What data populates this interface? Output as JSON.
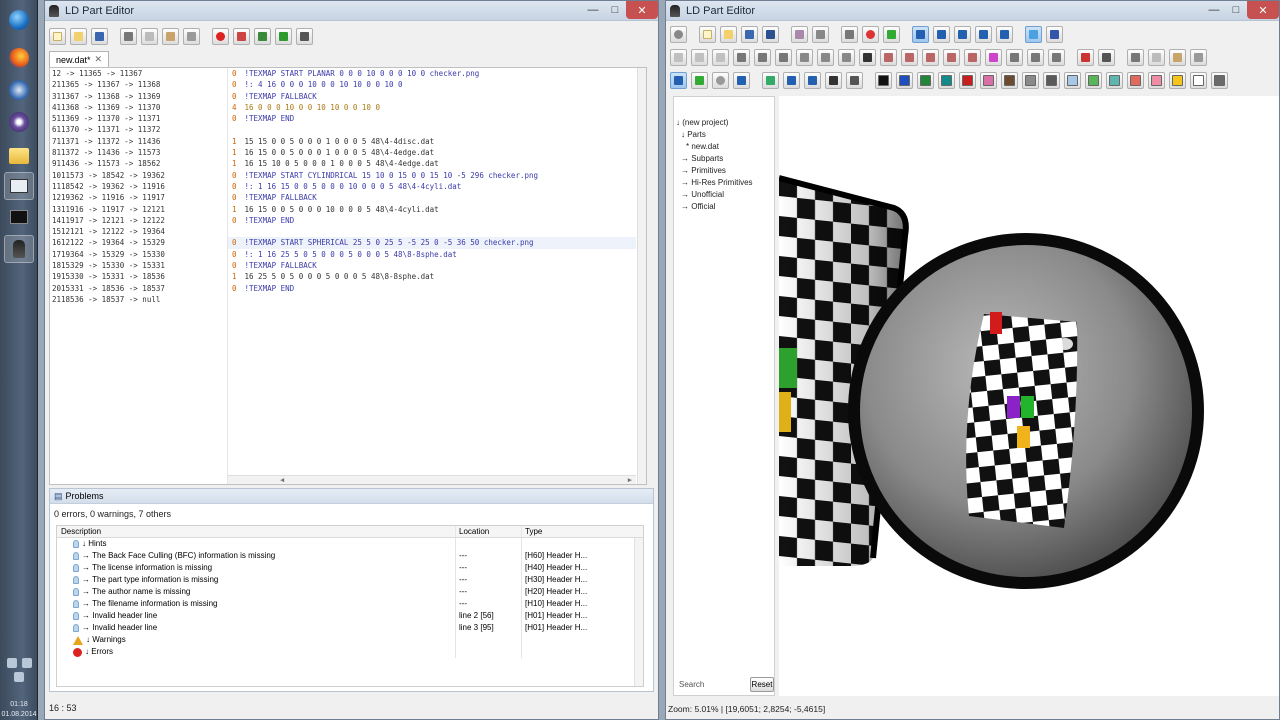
{
  "taskbar": {
    "clock": {
      "time": "01:18",
      "date": "01.08.2014"
    }
  },
  "left_window": {
    "title": "LD Part Editor",
    "tab_label": "new.dat*",
    "gutter_lines": [
      "12 -> 11365 -> 11367",
      "211365 -> 11367 -> 11368",
      "311367 -> 11368 -> 11369",
      "411368 -> 11369 -> 11370",
      "511369 -> 11370 -> 11371",
      "611370 -> 11371 -> 11372",
      "711371 -> 11372 -> 11436",
      "811372 -> 11436 -> 11573",
      "911436 -> 11573 -> 18562",
      "1011573 -> 18542 -> 19362",
      "1118542 -> 19362 -> 11916",
      "1219362 -> 11916 -> 11917",
      "1311916 -> 11917 -> 12121",
      "1411917 -> 12121 -> 12122",
      "1512121 -> 12122 -> 19364",
      "1612122 -> 19364 -> 15329",
      "1719364 -> 15329 -> 15330",
      "1815329 -> 15330 -> 15331",
      "1915330 -> 15331 -> 18536",
      "2015331 -> 18536 -> 18537",
      "2118536 -> 18537 -> null"
    ],
    "code_lines": [
      {
        "n": "0",
        "text": "!TEXMAP START PLANAR 0 0 0 10 0 0 0 10 0 checker.png",
        "kind": "meta"
      },
      {
        "n": "0",
        "text": "!: 4 16 0 0 0 10 0 0 10 10 0 0 10 0",
        "kind": "meta"
      },
      {
        "n": "0",
        "text": "!TEXMAP FALLBACK",
        "kind": "meta"
      },
      {
        "n": "4",
        "text": "16 0 0 0 10 0 0 10 10 0 0 10 0",
        "kind": "nums"
      },
      {
        "n": "0",
        "text": "!TEXMAP END",
        "kind": "meta"
      },
      {
        "n": "",
        "text": "",
        "kind": "blank"
      },
      {
        "n": "1",
        "text": "15 15 0 0 5 0 0 0 1 0 0 0 5 48\\4-4disc.dat",
        "kind": "sub"
      },
      {
        "n": "1",
        "text": "16 15 0 0 5 0 0 0 1 0 0 0 5 48\\4-4edge.dat",
        "kind": "sub"
      },
      {
        "n": "1",
        "text": "16 15 10 0 5 0 0 0 1 0 0 0 5 48\\4-4edge.dat",
        "kind": "sub"
      },
      {
        "n": "0",
        "text": "!TEXMAP START CYLINDRICAL 15 10 0 15 0 0 15 10 -5 296 checker.png",
        "kind": "meta"
      },
      {
        "n": "0",
        "text": "!: 1 16 15 0 0 5 0 0 0 10 0 0 0 5 48\\4-4cyli.dat",
        "kind": "meta"
      },
      {
        "n": "0",
        "text": "!TEXMAP FALLBACK",
        "kind": "meta"
      },
      {
        "n": "1",
        "text": "16 15 0 0 5 0 0 0 10 0 0 0 5 48\\4-4cyli.dat",
        "kind": "sub"
      },
      {
        "n": "0",
        "text": "!TEXMAP END",
        "kind": "meta"
      },
      {
        "n": "",
        "text": "",
        "kind": "blank"
      },
      {
        "n": "0",
        "text": "!TEXMAP START SPHERICAL 25 5 0 25 5 -5 25 0 -5 36 50 checker.png",
        "kind": "meta"
      },
      {
        "n": "0",
        "text": "!: 1 16 25 5 0 5 0 0 0 5 0 0 0 5 48\\8-8sphe.dat",
        "kind": "meta"
      },
      {
        "n": "0",
        "text": "!TEXMAP FALLBACK",
        "kind": "meta"
      },
      {
        "n": "1",
        "text": "16 25 5 0 5 0 0 0 5 0 0 0 5 48\\8-8sphe.dat",
        "kind": "sub"
      },
      {
        "n": "0",
        "text": "!TEXMAP END",
        "kind": "meta"
      }
    ],
    "problems": {
      "title": "Problems",
      "summary": "0 errors, 0 warnings, 7 others",
      "columns": [
        "Description",
        "Location",
        "Type"
      ],
      "rows": [
        {
          "indent": 1,
          "icon": "hint",
          "desc": "↓ Hints",
          "loc": "",
          "type": ""
        },
        {
          "indent": 2,
          "icon": "hint",
          "desc": "→ The Back Face Culling (BFC) information is missing",
          "loc": "---",
          "type": "[H60] Header H..."
        },
        {
          "indent": 2,
          "icon": "hint",
          "desc": "→ The license information is missing",
          "loc": "---",
          "type": "[H40] Header H..."
        },
        {
          "indent": 2,
          "icon": "hint",
          "desc": "→ The part type information is missing",
          "loc": "---",
          "type": "[H30] Header H..."
        },
        {
          "indent": 2,
          "icon": "hint",
          "desc": "→ The author name is missing",
          "loc": "---",
          "type": "[H20] Header H..."
        },
        {
          "indent": 2,
          "icon": "hint",
          "desc": "→ The filename information is missing",
          "loc": "---",
          "type": "[H10] Header H..."
        },
        {
          "indent": 2,
          "icon": "hint",
          "desc": "→ Invalid header line",
          "loc": "line 2   [56]",
          "type": "[H01] Header H..."
        },
        {
          "indent": 2,
          "icon": "hint",
          "desc": "→ Invalid header line",
          "loc": "line 3   [95]",
          "type": "[H01] Header H..."
        },
        {
          "indent": 1,
          "icon": "warn",
          "desc": "↓ Warnings",
          "loc": "",
          "type": ""
        },
        {
          "indent": 1,
          "icon": "err",
          "desc": "↓ Errors",
          "loc": "",
          "type": ""
        }
      ]
    },
    "status": "16 : 53"
  },
  "right_window": {
    "title": "LD Part Editor",
    "tree": [
      {
        "indent": 0,
        "label": "↓ (new project)"
      },
      {
        "indent": 1,
        "label": "↓ Parts"
      },
      {
        "indent": 2,
        "label": "* new.dat"
      },
      {
        "indent": 1,
        "label": "→ Subparts"
      },
      {
        "indent": 1,
        "label": "→ Primitives"
      },
      {
        "indent": 1,
        "label": "→ Hi-Res Primitives"
      },
      {
        "indent": 1,
        "label": "→ Unofficial"
      },
      {
        "indent": 1,
        "label": "→ Official"
      }
    ],
    "search_placeholder": "Search",
    "reset_label": "Reset",
    "status": "Zoom: 5.01% | [19,6051; 2,8254; -5,4615]",
    "palette": [
      "#111111",
      "#1f4fbf",
      "#23853a",
      "#138a8a",
      "#c81e1e",
      "#d870a6",
      "#6b4a2e",
      "#8a8a8a",
      "#5a5a5a",
      "#a7c7e6",
      "#5ab45a",
      "#5fb5b0",
      "#e06a5e",
      "#f08ca5",
      "#f5c518",
      "#ffffff",
      "#6a6a6a"
    ]
  }
}
